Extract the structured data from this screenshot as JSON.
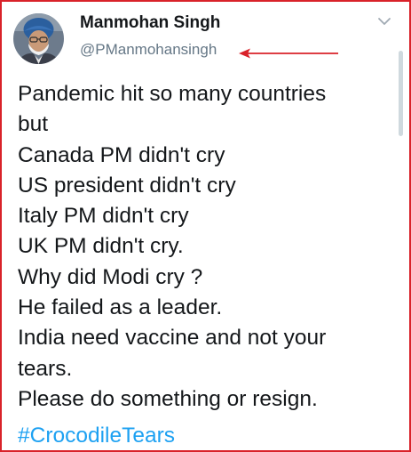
{
  "tweet": {
    "author": {
      "display_name": "Manmohan Singh",
      "handle": "@PManmohansingh",
      "avatar_icon": "profile-photo-avatar"
    },
    "menu_icon": "chevron-down-icon",
    "lines": [
      "Pandemic hit so many countries",
      "but",
      "Canada PM didn't cry",
      "US president didn't cry",
      "Italy PM didn't cry",
      "UK PM didn't cry.",
      "Why did Modi cry ?",
      "He failed as a leader.",
      "India need vaccine and not your",
      "tears.",
      "Please do something or resign."
    ],
    "hashtag": "#CrocodileTears"
  },
  "annotation": {
    "arrow_icon": "red-arrow-icon",
    "color": "#d9222a"
  },
  "colors": {
    "text": "#14171a",
    "secondary_text": "#657786",
    "link": "#1da1f2",
    "frame_border": "#d9222a"
  }
}
